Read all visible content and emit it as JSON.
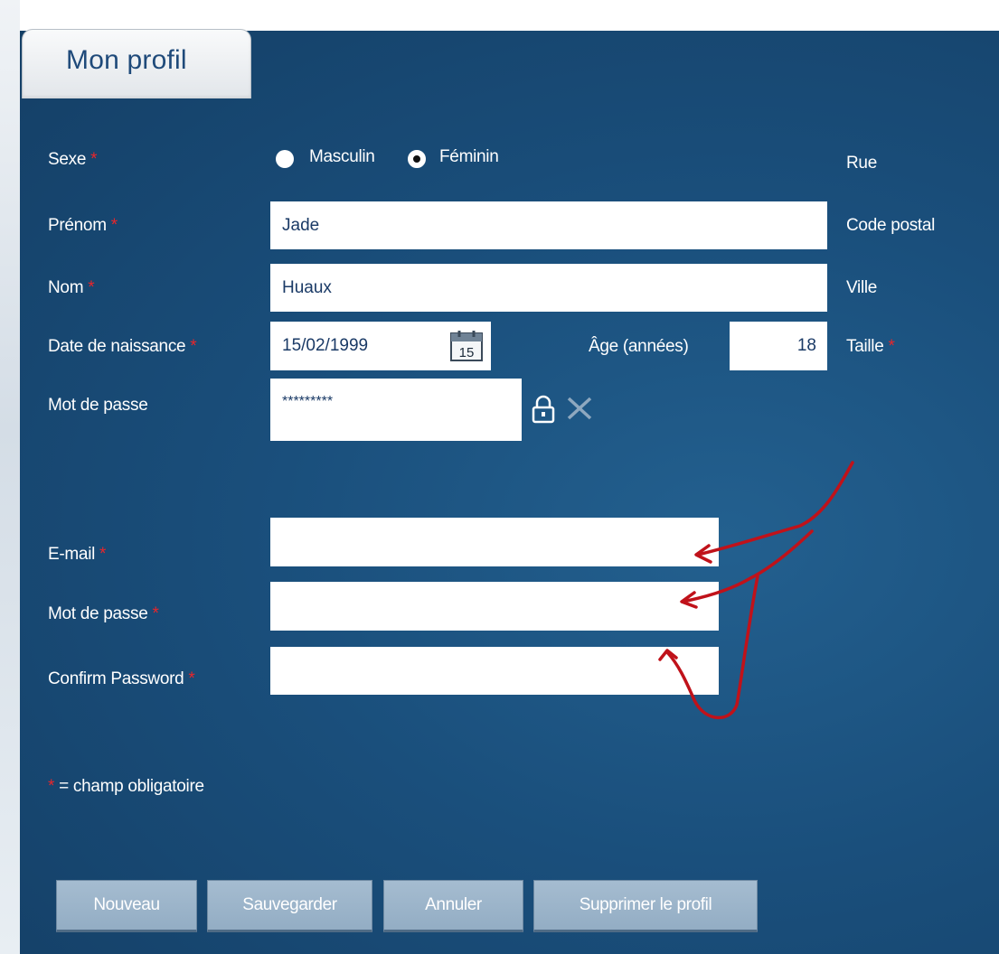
{
  "tab": {
    "title": "Mon profil"
  },
  "required_marker": "*",
  "labels": {
    "sexe": "Sexe",
    "prenom": "Prénom",
    "nom": "Nom",
    "date_naissance": "Date de naissance",
    "mot_de_passe_current": "Mot de passe",
    "email": "E-mail",
    "mot_de_passe": "Mot de passe",
    "confirm_password": "Confirm Password",
    "age": "Âge (années)",
    "rue": "Rue",
    "code_postal": "Code postal",
    "ville": "Ville",
    "taille": "Taille"
  },
  "gender": {
    "options": [
      "Masculin",
      "Féminin"
    ],
    "selected": "Féminin"
  },
  "fields": {
    "prenom": "Jade",
    "nom": "Huaux",
    "date_naissance": "15/02/1999",
    "age": "18",
    "password_masked": "*********",
    "email": "",
    "new_password": "",
    "confirm_password": ""
  },
  "calendar_day": "15",
  "legend": {
    "text": " = champ obligatoire"
  },
  "buttons": {
    "nouveau": "Nouveau",
    "sauvegarder": "Sauvegarder",
    "annuler": "Annuler",
    "supprimer": "Supprimer le profil"
  },
  "icons": {
    "calendar": "calendar-icon",
    "lock": "lock-icon",
    "clear": "close-icon",
    "radio_unchecked": "radio-unchecked-icon",
    "radio_checked": "radio-checked-icon"
  },
  "colors": {
    "panel_background": "#1a4f7c",
    "label_text": "#ffffff",
    "required_marker": "#e8262b",
    "tab_title": "#1f4a7a",
    "button_background": "#9fb6ca",
    "annotation_stroke": "#c0121a"
  }
}
